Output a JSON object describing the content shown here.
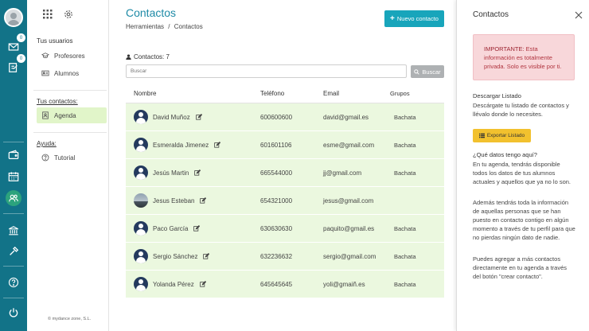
{
  "rail": {
    "mail_badge": "0",
    "notes_badge": "0"
  },
  "sidebar": {
    "users_heading": "Tus usuarios",
    "items_users": [
      {
        "label": "Profesores"
      },
      {
        "label": "Alumnos"
      }
    ],
    "contacts_heading": "Tus contactos:",
    "agenda_label": "Agenda",
    "help_heading": "Ayuda:",
    "tutorial_label": "Tutorial",
    "copyright": "© mydance zone, S.L."
  },
  "main": {
    "title": "Contactos",
    "breadcrumb": {
      "root": "Herramientas",
      "sep": "/",
      "current": "Contactos"
    },
    "new_contact_label": "Nuevo contacto",
    "count_label": "Contactos: 7",
    "search_placeholder": "Buscar",
    "search_button": "Buscar",
    "columns": {
      "name": "Nombre",
      "phone": "Teléfono",
      "email": "Email",
      "groups": "Grupos"
    },
    "rows": [
      {
        "name": "David Muñoz",
        "phone": "600600600",
        "email": "david@gmail.es",
        "group": "Bachata",
        "photo": false
      },
      {
        "name": "Esmeralda Jimenez",
        "phone": "601601106",
        "email": "esme@gmail.com",
        "group": "Bachata",
        "photo": false
      },
      {
        "name": "Jesús Martin",
        "phone": "665544000",
        "email": "jj@gmail.com",
        "group": "Bachata",
        "photo": false
      },
      {
        "name": "Jesus Esteban",
        "phone": "654321000",
        "email": "jesus@gmail.com",
        "group": "",
        "photo": true
      },
      {
        "name": "Paco García",
        "phone": "630630630",
        "email": "paquito@gmail.es",
        "group": "Bachata",
        "photo": false
      },
      {
        "name": "Sergio Sánchez",
        "phone": "632236632",
        "email": "sergio@gmail.com",
        "group": "Bachata",
        "photo": false
      },
      {
        "name": "Yolanda Pérez",
        "phone": "645645645",
        "email": "yoli@gmaiñ.es",
        "group": "Bachata",
        "photo": false
      }
    ]
  },
  "panel": {
    "title": "Contactos",
    "alert_strong": "IMPORTANTE:",
    "alert_text": " Esta información es totalmente privada. Solo es visible por ti.",
    "download_heading": "Descargar Listado",
    "download_text": "Descárgate tu listado de contactos y llévalo donde lo necesites.",
    "export_label": "Exportar Listado",
    "question_heading": "¿Qué datos tengo aquí?",
    "para1": "En tu agenda, tendrás disponible todos los datos de tus alumnos actuales y aquellos que ya no lo son.",
    "para2": "Además tendrás toda la información de aquellas personas que se han puesto en contacto contigo en algún momento a través de tu perfil para que no pierdas ningún dato de nadie.",
    "para3": "Puedes agregar a más contactos directamente en tu agenda a través del botón \"crear contacto\"."
  },
  "colors": {
    "rail": "#127388",
    "accent": "#18a5bb",
    "row_bg": "#ebf8df",
    "export": "#f2c12e",
    "alert_bg": "#f8d7da"
  }
}
